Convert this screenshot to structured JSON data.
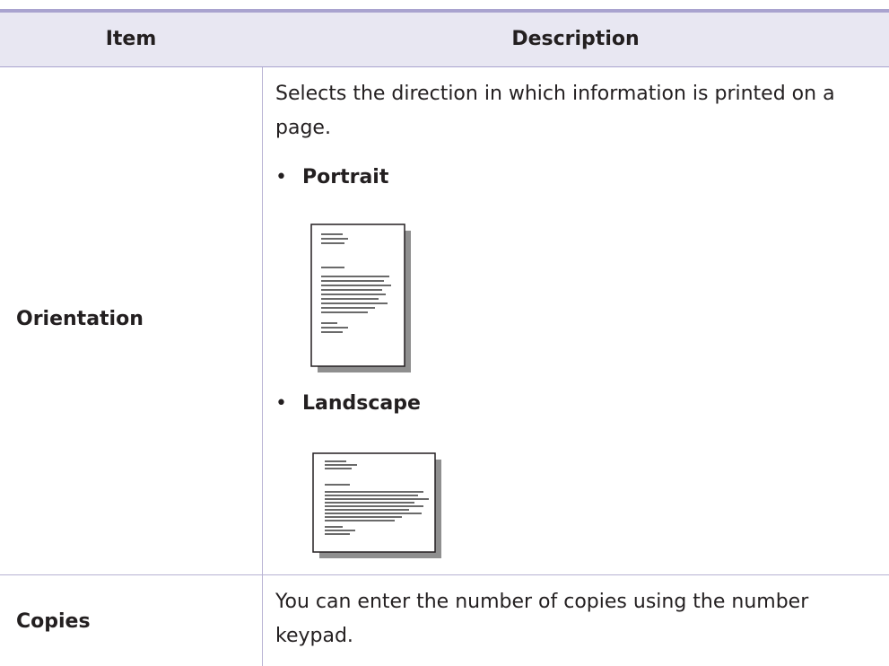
{
  "table": {
    "headers": {
      "item": "Item",
      "description": "Description"
    },
    "rows": [
      {
        "item": "Orientation",
        "description": "Selects the direction in which information is printed on a page.",
        "options": [
          {
            "label": "Portrait",
            "icon": "portrait-page-icon"
          },
          {
            "label": "Landscape",
            "icon": "landscape-page-icon"
          }
        ]
      },
      {
        "item": "Copies",
        "description": "You can enter the number of copies using the number keypad."
      }
    ]
  },
  "colors": {
    "header_bg": "#e8e7f2",
    "rule": "#a9a3cf",
    "text": "#231f20"
  }
}
